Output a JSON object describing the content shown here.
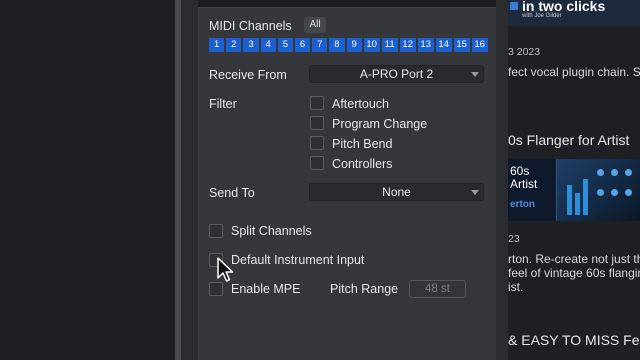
{
  "panel": {
    "midi_channels_label": "MIDI Channels",
    "all_button": "All",
    "channels": [
      "1",
      "2",
      "3",
      "4",
      "5",
      "6",
      "7",
      "8",
      "9",
      "10",
      "11",
      "12",
      "13",
      "14",
      "15",
      "16"
    ],
    "receive_from_label": "Receive From",
    "receive_from_value": "A-PRO Port 2",
    "filter_label": "Filter",
    "filters": [
      "Aftertouch",
      "Program Change",
      "Pitch Bend",
      "Controllers"
    ],
    "send_to_label": "Send To",
    "send_to_value": "None",
    "split_channels": "Split Channels",
    "default_instrument_input": "Default Instrument Input",
    "enable_mpe": "Enable MPE",
    "pitch_range_label": "Pitch Range",
    "pitch_range_value": "48 st"
  },
  "right": {
    "thumb_title": "in two clicks",
    "thumb_sub": "with Joe Gilder",
    "date1": "3 2023",
    "desc1": "fect vocal plugin chain. S",
    "title2": "0s Flanger for Artist",
    "thumb2_line1": "60s",
    "thumb2_line2": "Artist",
    "thumb2_brand": "erton",
    "date2": "23",
    "desc2_line1": "rton. Re-create not just th",
    "desc2_line2": "feel of vintage 60s flangin",
    "desc2_line3": "ist.",
    "title3": "& EASY TO MISS Fe"
  },
  "colors": {
    "accent_blue": "#1b5fd0",
    "panel_bg": "#36373b"
  }
}
